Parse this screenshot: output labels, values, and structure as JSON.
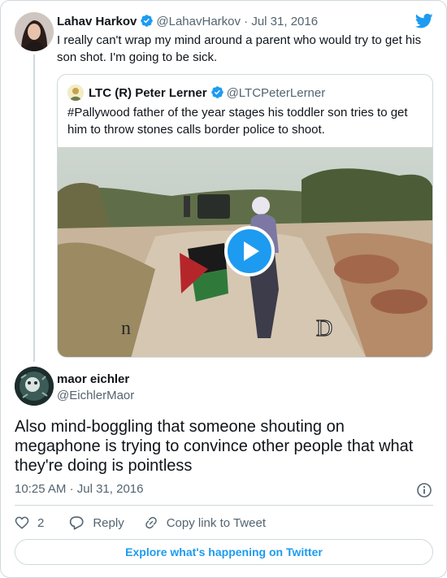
{
  "parent_tweet": {
    "name": "Lahav Harkov",
    "handle": "@LahavHarkov",
    "separator": "·",
    "date": "Jul 31, 2016",
    "text": "I really can't wrap my mind around a parent who would try to get his son shot. I'm going to be sick."
  },
  "quoted_tweet": {
    "name": "LTC (R) Peter Lerner",
    "handle": "@LTCPeterLerner",
    "text": "#Pallywood father of the year stages his toddler son tries to get him to throw stones calls border police to shoot.",
    "media_type": "video",
    "caption_left": "n",
    "caption_right": "D"
  },
  "main_tweet": {
    "name": "maor eichler",
    "handle": "@EichlerMaor",
    "text": "Also mind-boggling that someone shouting on megaphone is trying to convince other people that what they're doing is pointless",
    "time": "10:25 AM",
    "separator": "·",
    "date": "Jul 31, 2016"
  },
  "actions": {
    "like_count": "2",
    "reply_label": "Reply",
    "copy_link_label": "Copy link to Tweet"
  },
  "explore_label": "Explore what's happening on Twitter",
  "icons": [
    "twitter-bird-icon",
    "verified-badge-icon",
    "play-icon",
    "info-icon",
    "heart-icon",
    "reply-icon",
    "link-icon"
  ],
  "colors": {
    "accent": "#1d9bf0",
    "text": "#0f1419",
    "secondary": "#536471",
    "border": "#cfd9de"
  }
}
